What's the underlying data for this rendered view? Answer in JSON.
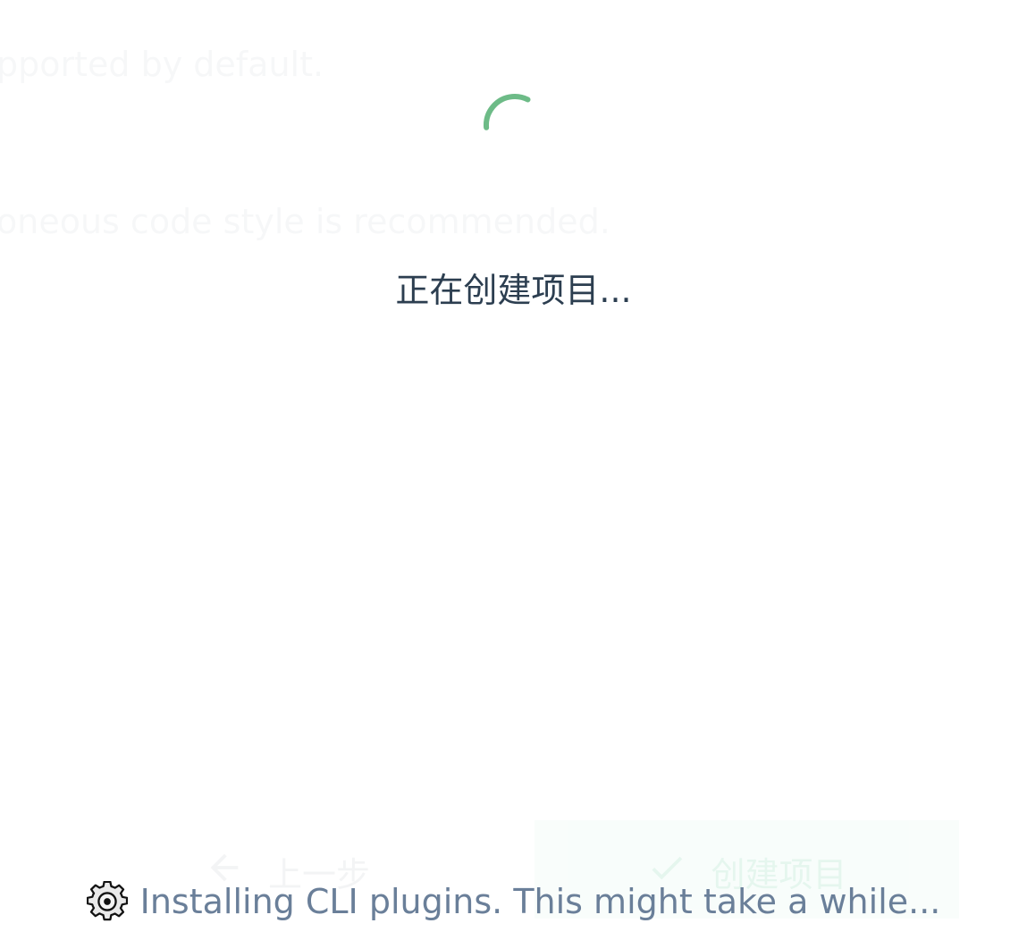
{
  "background": {
    "line1": "pported by default.",
    "line2": "oneous code style is recommended.",
    "prev_button_label": "上一步",
    "create_button_label": "创建项目"
  },
  "loading": {
    "title": "正在创建项目...",
    "progress_message": "Installing CLI plugins. This might take a while...",
    "spinner_icon": "loading-spinner-icon",
    "status_icon": "gear-icon"
  },
  "colors": {
    "accent": "#42b983",
    "text": "#2c3e50",
    "muted_text": "#6a7f99"
  }
}
